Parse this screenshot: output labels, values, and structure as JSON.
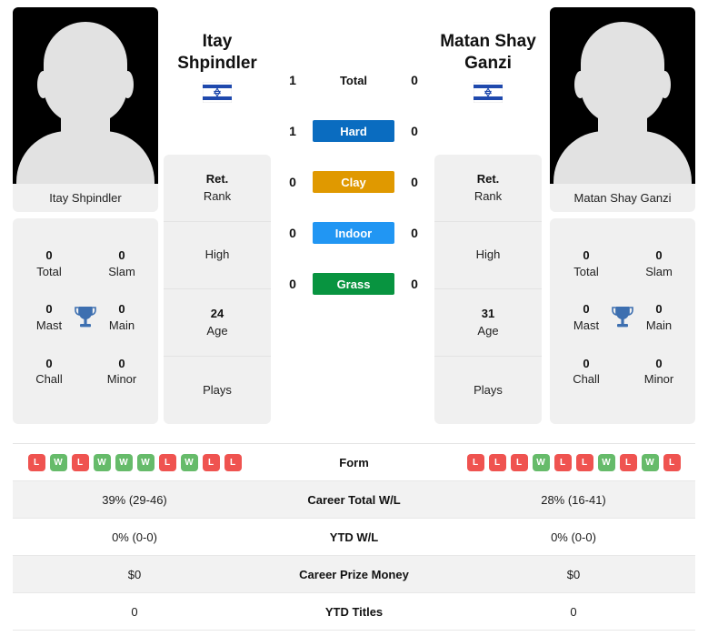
{
  "players": {
    "left": {
      "name": "Itay Shpindler",
      "name_line1": "Itay",
      "name_line2": "Shpindler",
      "flag": "israel-flag-icon",
      "rank_value": "Ret.",
      "rank_label": "Rank",
      "high_value": "",
      "high_label": "High",
      "age_value": "24",
      "age_label": "Age",
      "plays_value": "",
      "plays_label": "Plays",
      "titles": [
        {
          "value": "0",
          "label": "Total"
        },
        {
          "value": "0",
          "label": "Slam"
        },
        {
          "value": "0",
          "label": "Mast"
        },
        {
          "value": "0",
          "label": "Main"
        },
        {
          "value": "0",
          "label": "Chall"
        },
        {
          "value": "0",
          "label": "Minor"
        }
      ],
      "form": [
        "L",
        "W",
        "L",
        "W",
        "W",
        "W",
        "L",
        "W",
        "L",
        "L"
      ],
      "career_total_wl": "39% (29-46)",
      "ytd_wl": "0% (0-0)",
      "career_prize_money": "$0",
      "ytd_titles": "0"
    },
    "right": {
      "name": "Matan Shay Ganzi",
      "name_line1": "Matan Shay",
      "name_line2": "Ganzi",
      "flag": "israel-flag-icon",
      "rank_value": "Ret.",
      "rank_label": "Rank",
      "high_value": "",
      "high_label": "High",
      "age_value": "31",
      "age_label": "Age",
      "plays_value": "",
      "plays_label": "Plays",
      "titles": [
        {
          "value": "0",
          "label": "Total"
        },
        {
          "value": "0",
          "label": "Slam"
        },
        {
          "value": "0",
          "label": "Mast"
        },
        {
          "value": "0",
          "label": "Main"
        },
        {
          "value": "0",
          "label": "Chall"
        },
        {
          "value": "0",
          "label": "Minor"
        }
      ],
      "form": [
        "L",
        "L",
        "L",
        "W",
        "L",
        "L",
        "W",
        "L",
        "W",
        "L"
      ],
      "career_total_wl": "28% (16-41)",
      "ytd_wl": "0% (0-0)",
      "career_prize_money": "$0",
      "ytd_titles": "0"
    }
  },
  "head_to_head": [
    {
      "label": "Total",
      "left": "1",
      "right": "0",
      "color": "transparent",
      "plain": true
    },
    {
      "label": "Hard",
      "left": "1",
      "right": "0",
      "color": "#0a6cc0",
      "plain": false
    },
    {
      "label": "Clay",
      "left": "0",
      "right": "0",
      "color": "#e09900",
      "plain": false
    },
    {
      "label": "Indoor",
      "left": "0",
      "right": "0",
      "color": "#2196f3",
      "plain": false
    },
    {
      "label": "Grass",
      "left": "0",
      "right": "0",
      "color": "#089440",
      "plain": false
    }
  ],
  "stats_rows": [
    {
      "label": "Form",
      "left": "",
      "right": "",
      "type": "form",
      "shaded": false
    },
    {
      "label": "Career Total W/L",
      "left": "39% (29-46)",
      "right": "28% (16-41)",
      "type": "text",
      "shaded": true
    },
    {
      "label": "YTD W/L",
      "left": "0% (0-0)",
      "right": "0% (0-0)",
      "type": "text",
      "shaded": false
    },
    {
      "label": "Career Prize Money",
      "left": "$0",
      "right": "$0",
      "type": "text",
      "shaded": true
    },
    {
      "label": "YTD Titles",
      "left": "0",
      "right": "0",
      "type": "text",
      "shaded": false
    }
  ],
  "colors": {
    "win": "#66bb6a",
    "loss": "#ef5350",
    "hard": "#0a6cc0",
    "clay": "#e09900",
    "indoor": "#2196f3",
    "grass": "#089440",
    "trophy": "#3d6fb0",
    "panel": "#f0f0f0"
  }
}
